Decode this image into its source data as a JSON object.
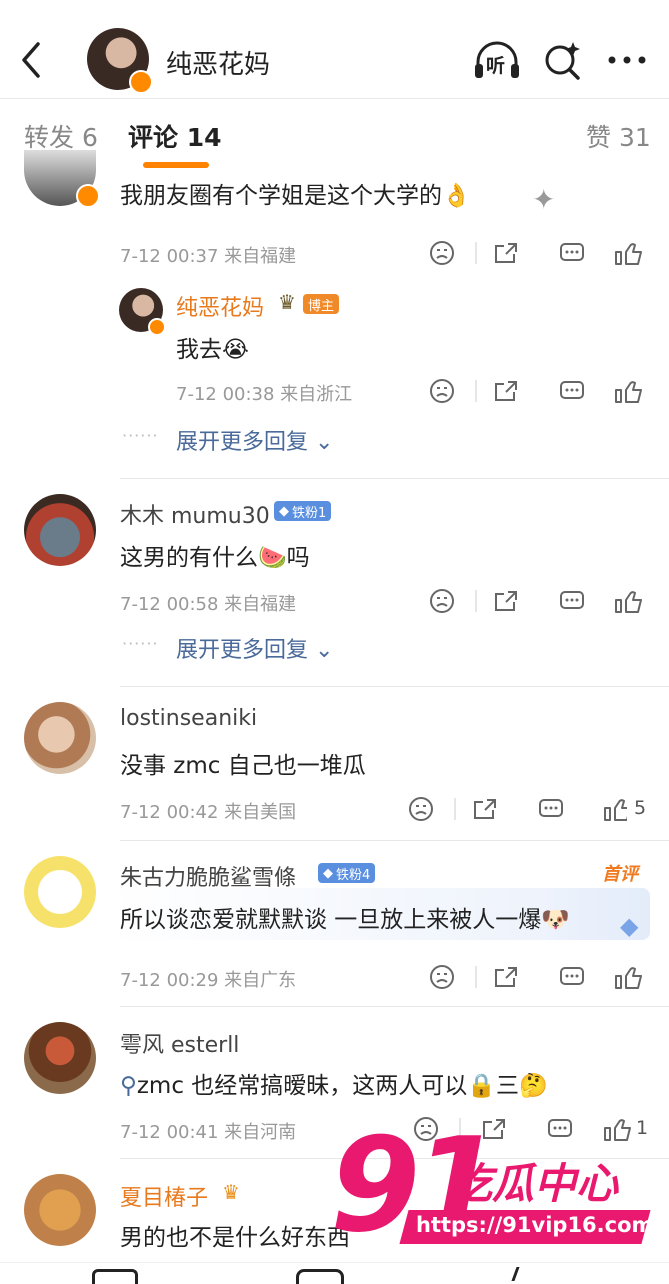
{
  "header": {
    "title": "纯恶花妈",
    "listen_label": "听",
    "back_icon": "chevron-left-icon",
    "search_icon": "search-sparkle-icon",
    "more_icon": "more-dots-icon"
  },
  "tabs": {
    "repost": "转发 6",
    "comments": "评论 14",
    "likes": "赞 31"
  },
  "comments": [
    {
      "text": "我朋友圈有个学姐是这个大学的",
      "meta": "7-12 00:37 来自福建",
      "reply": {
        "name": "纯恶花妈",
        "badge": "博主",
        "text": "我去",
        "meta": "7-12 00:38 来自浙江"
      },
      "expand": "展开更多回复"
    },
    {
      "name": "木木 mumu30",
      "badge": "铁粉1",
      "text": "这男的有什么",
      "text_after": "吗",
      "meta": "7-12 00:58 来自福建",
      "expand": "展开更多回复"
    },
    {
      "name": "lostinseaniki",
      "text": "没事 zmc 自己也一堆瓜",
      "meta": "7-12 00:42 来自美国",
      "likes": "5"
    },
    {
      "name": "朱古力脆脆鲨雪條",
      "badge": "铁粉4",
      "tag": "首评",
      "text": "所以谈恋爱就默默谈 一旦放上来被人一爆",
      "meta": "7-12 00:29 来自广东"
    },
    {
      "name": "雩风 esterll",
      "text": "zmc 也经常搞暧昧，这两人可以",
      "text_after": "三",
      "meta": "7-12 00:41 来自河南",
      "likes": "1"
    },
    {
      "name": "夏目椿子",
      "text": "男的也不是什么好东西"
    }
  ],
  "watermark": {
    "number": "91",
    "brand": "吃瓜中心",
    "url": "https://91vip16.com"
  },
  "colors": {
    "accent": "#ff8200",
    "link": "#4a6a9a",
    "watermark": "#e8196e"
  }
}
